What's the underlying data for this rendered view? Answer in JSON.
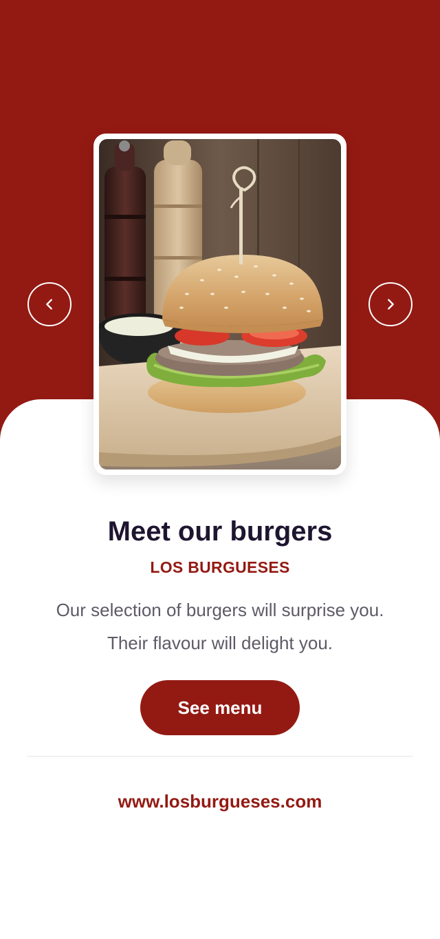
{
  "hero": {
    "background_color": "#931a13",
    "image_subject": "burger-photo",
    "prev_icon": "chevron-left-icon",
    "next_icon": "chevron-right-icon"
  },
  "content": {
    "title": "Meet our burgers",
    "brand": "LOS BURGUESES",
    "description": "Our selection of burgers will surprise you. Their flavour will delight you.",
    "cta_label": "See menu"
  },
  "footer": {
    "website": "www.losburgueses.com"
  },
  "colors": {
    "accent": "#931a13",
    "title": "#1e1530",
    "body_text": "#5e5a66"
  }
}
